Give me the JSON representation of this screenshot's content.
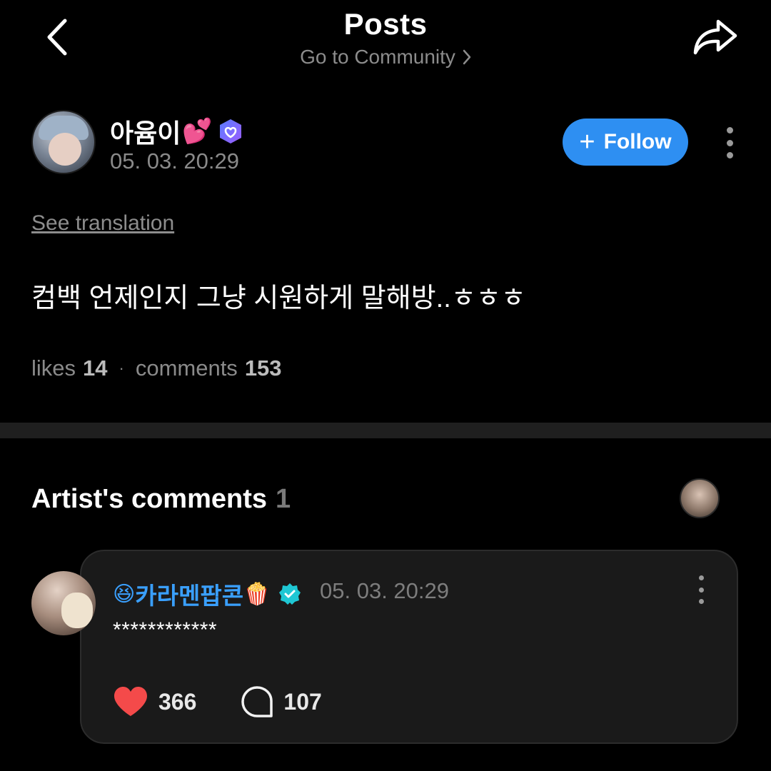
{
  "header": {
    "title": "Posts",
    "community_link": "Go to Community",
    "back_icon": "chevron-left-icon",
    "share_icon": "share-arrow-icon"
  },
  "post": {
    "author": {
      "name": "아윰이",
      "name_emoji": "💕",
      "badge": "verified-badge-blue",
      "timestamp": "05. 03. 20:29"
    },
    "follow_label": "Follow",
    "see_translation": "See translation",
    "body": "컴백 언제인지 그냥 시원하게 말해방..ㅎㅎㅎ",
    "stats": {
      "likes_label": "likes",
      "likes_count": "14",
      "separator": "·",
      "comments_label": "comments",
      "comments_count": "153"
    }
  },
  "artist_comments": {
    "title": "Artist's comments",
    "count": "1",
    "comment": {
      "prefix_emoji": "😆",
      "author": "카라멘팝콘",
      "suffix_emoji": "🍿",
      "badge": "verified-badge-teal",
      "timestamp": "05. 03. 20:29",
      "text": "************",
      "likes": "366",
      "replies": "107"
    }
  },
  "colors": {
    "background": "#000000",
    "accent_blue": "#2e8ff2",
    "artist_name": "#3aa0ff",
    "heart": "#f44a4a",
    "muted_text": "#8a8a8a",
    "card_bg": "#1a1a1a"
  }
}
